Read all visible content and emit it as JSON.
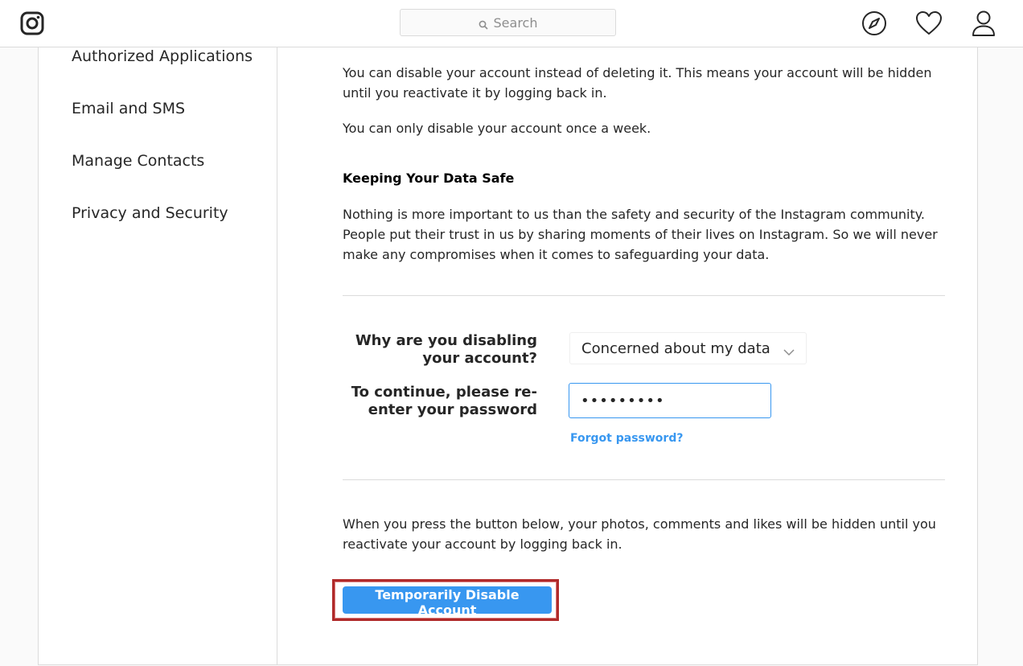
{
  "header": {
    "search_placeholder": "Search"
  },
  "sidebar": {
    "items": [
      {
        "label": "Authorized Applications"
      },
      {
        "label": "Email and SMS"
      },
      {
        "label": "Manage Contacts"
      },
      {
        "label": "Privacy and Security"
      }
    ]
  },
  "main": {
    "intro": "You can disable your account instead of deleting it. This means your account will be hidden until you reactivate it by logging back in.",
    "once_week": "You can only disable your account once a week.",
    "data_safe_heading": "Keeping Your Data Safe",
    "data_safe_text": "Nothing is more important to us than the safety and security of the Instagram community. People put their trust in us by sharing moments of their lives on Instagram. So we will never make any compromises when it comes to safeguarding your data.",
    "reason_label": "Why are you disabling your account?",
    "reason_value": "Concerned about my data",
    "password_label": "To continue, please re-enter your password",
    "password_value": "•••••••••",
    "forgot_link": "Forgot password?",
    "warning_text": "When you press the button below, your photos, comments and likes will be hidden until you reactivate your account by logging back in.",
    "disable_button": "Temporarily Disable Account"
  },
  "colors": {
    "accent": "#3897f0",
    "highlight_border": "#b02a2a",
    "border": "#dbdbdb"
  }
}
